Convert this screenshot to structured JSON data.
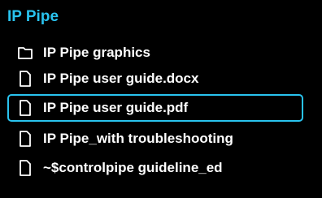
{
  "folder": {
    "title": "IP Pipe"
  },
  "items": [
    {
      "label": "IP Pipe graphics",
      "icon": "folder-icon",
      "selected": false
    },
    {
      "label": "IP Pipe user guide.docx",
      "icon": "file-icon",
      "selected": false
    },
    {
      "label": "IP Pipe user guide.pdf",
      "icon": "file-icon",
      "selected": true
    },
    {
      "label": "IP Pipe_with troubleshooting",
      "icon": "file-icon",
      "selected": false
    },
    {
      "label": "~$controlpipe guideline_ed",
      "icon": "file-icon",
      "selected": false
    }
  ],
  "colors": {
    "accent": "#29c3ef",
    "background": "#000000",
    "text": "#ffffff"
  }
}
